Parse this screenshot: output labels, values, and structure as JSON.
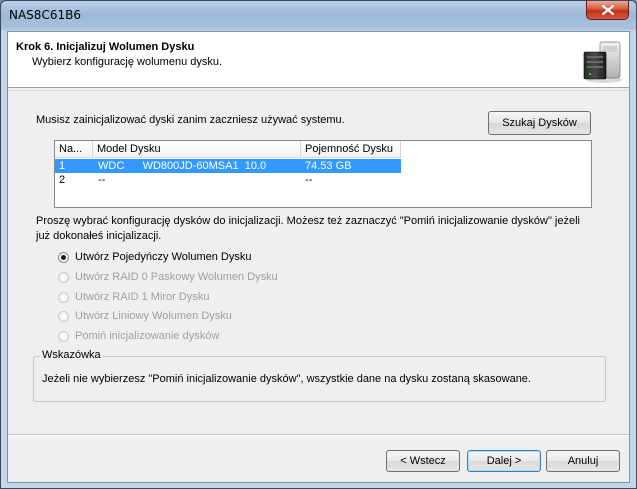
{
  "window": {
    "title": "NAS8C61B6",
    "close_label": "×"
  },
  "header": {
    "title": "Krok 6. Inicjalizuj Wolumen Dysku",
    "subtitle": "Wybierz konfigurację wolumenu dysku.",
    "icon": "nas-server-icon"
  },
  "main": {
    "must_init_text": "Musisz zainicjalizować dyski zanim zaczniesz używać systemu.",
    "search_button": "Szukaj Dysków",
    "table": {
      "columns": [
        "Na...",
        "Model Dysku",
        "Pojemność Dysku"
      ],
      "rows": [
        {
          "num": "1",
          "model": "WDC      WD800JD-60MSA1  10.0",
          "capacity": "74.53 GB",
          "selected": true
        },
        {
          "num": "2",
          "model": "--",
          "capacity": "--",
          "selected": false
        }
      ]
    },
    "choose_text": "Proszę wybrać konfigurację dysków do inicjalizacji. Możesz też zaznaczyć \"Pomiń inicjalizowanie dysków\" jeżeli już dokonałeś inicjalizacji.",
    "options": [
      {
        "label": "Utwórz Pojedyńczy Wolumen Dysku",
        "checked": true,
        "enabled": true
      },
      {
        "label": "Utwórz RAID 0 Paskowy Wolumen Dysku",
        "checked": false,
        "enabled": false
      },
      {
        "label": "Utwórz RAID 1 Miror Dysku",
        "checked": false,
        "enabled": false
      },
      {
        "label": "Utwórz Liniowy Wolumen Dysku",
        "checked": false,
        "enabled": false
      },
      {
        "label": "Pomiń inicjalizowanie dysków",
        "checked": false,
        "enabled": false
      }
    ],
    "hint": {
      "legend": "Wskazówka",
      "text": "Jeżeli nie wybierzesz \"Pomiń inicjalizowanie dysków\", wszystkie dane na dysku zostaną skasowane."
    }
  },
  "footer": {
    "back": "< Wstecz",
    "next": "Dalej >",
    "cancel": "Anuluj"
  },
  "colors": {
    "selection": "#3399ff",
    "close_button": "#c7402a"
  }
}
